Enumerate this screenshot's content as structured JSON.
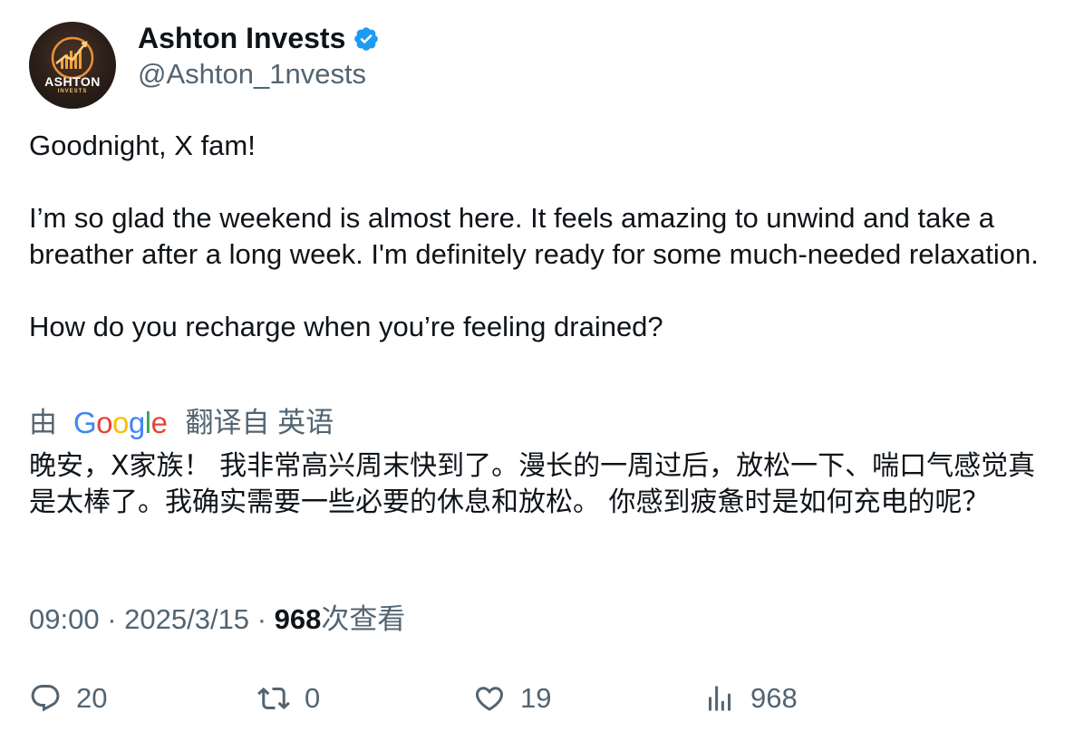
{
  "author": {
    "display_name": "Ashton Invests",
    "handle": "@Ashton_1nvests",
    "avatar": {
      "logo_text": "ASHTON",
      "logo_subtext": "INVESTS"
    },
    "verified_icon": "verified-badge-icon",
    "verified_color": "#1d9bf0"
  },
  "tweet": {
    "paragraphs": [
      "Goodnight, X fam!",
      "I’m so glad the weekend is almost here. It feels amazing to unwind and take a breather after a long week. I'm definitely ready for some much-needed relaxation.",
      "How do you recharge when you’re feeling drained?"
    ]
  },
  "translation": {
    "by_label": "由",
    "provider": "Google",
    "from_label": "翻译自 英语",
    "text": "晚安，X家族！ 我非常高兴周末快到了。漫长的一周过后，放松一下、喘口气感觉真是太棒了。我确实需要一些必要的休息和放松。 你感到疲惫时是如何充电的呢？"
  },
  "meta": {
    "time": "09:00",
    "date": "2025/3/15",
    "views": "968",
    "views_label": "次查看"
  },
  "actions": {
    "reply": {
      "icon": "reply-icon",
      "count": "20"
    },
    "retweet": {
      "icon": "retweet-icon",
      "count": "0"
    },
    "like": {
      "icon": "heart-icon",
      "count": "19"
    },
    "views": {
      "icon": "analytics-icon",
      "count": "968"
    }
  },
  "colors": {
    "text_primary": "#0f1419",
    "text_secondary": "#536471",
    "accent": "#1d9bf0"
  }
}
